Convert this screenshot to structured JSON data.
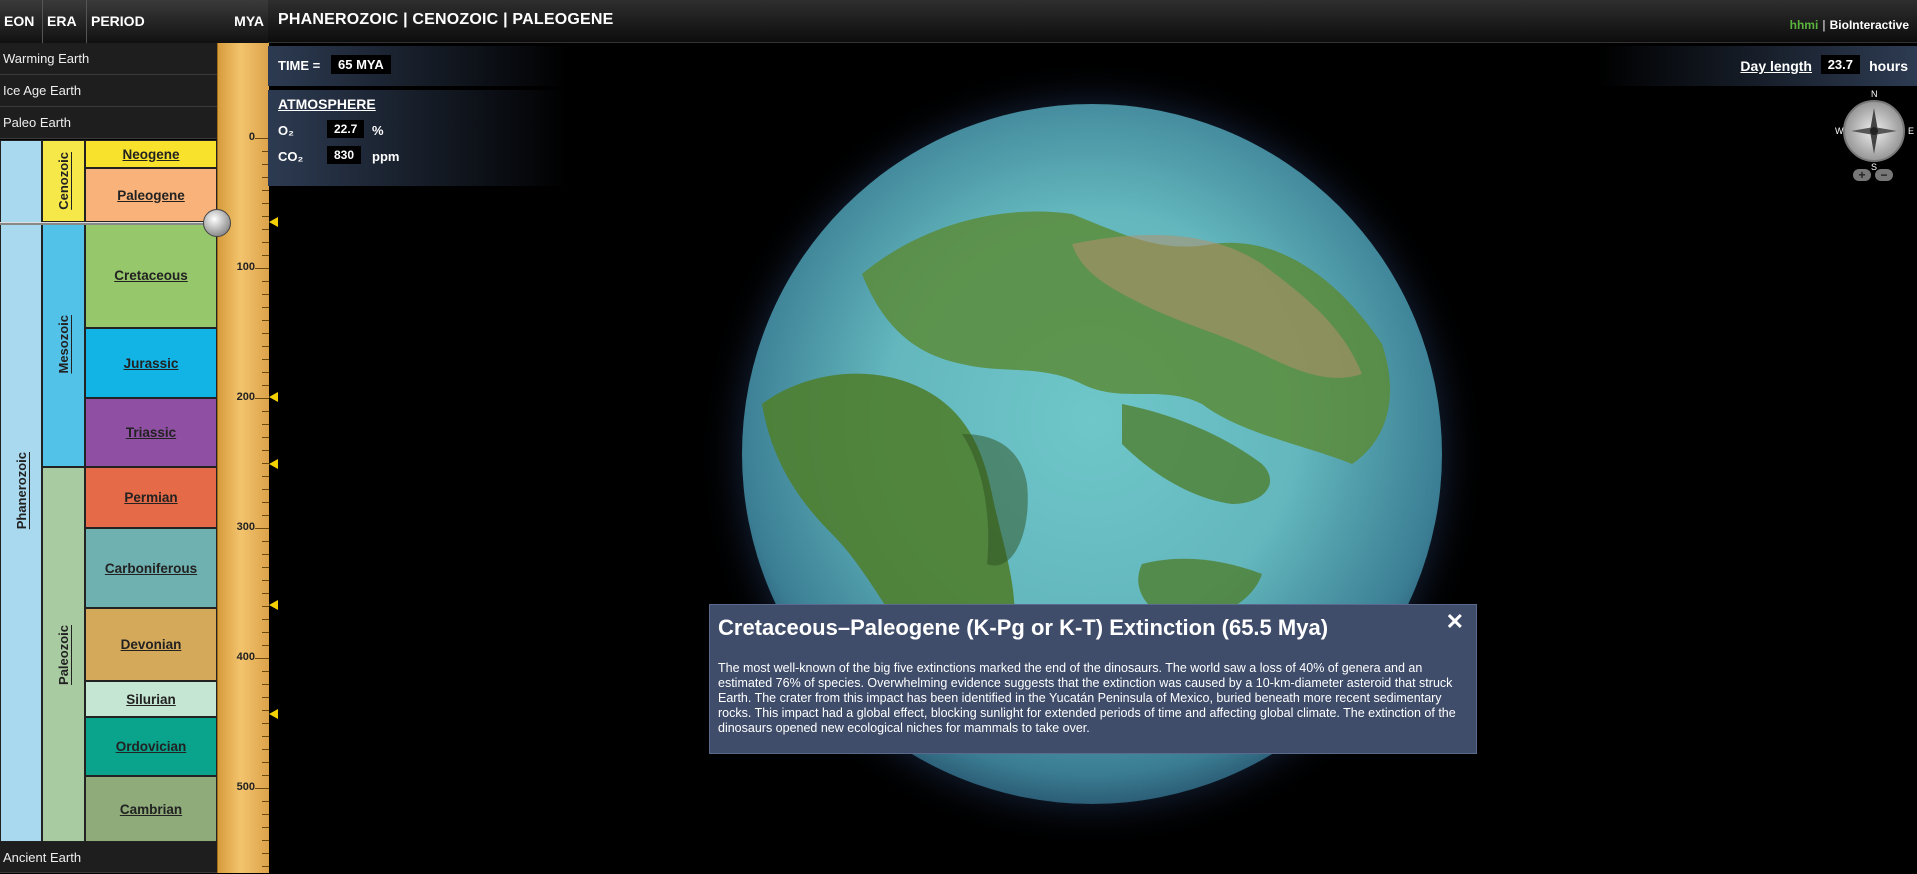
{
  "columns": {
    "eon": "EON",
    "era": "ERA",
    "period": "PERIOD",
    "mya": "MYA"
  },
  "breadcrumb": "PHANEROZOIC | CENOZOIC | PALEOGENE",
  "brand": {
    "hhmi": "hhmi",
    "sep": "|",
    "name": "BioInteractive"
  },
  "menu": {
    "warming": "Warming Earth",
    "ice_age": "Ice Age Earth",
    "paleo": "Paleo Earth",
    "ancient": "Ancient Earth"
  },
  "eon": {
    "label": "Phanerozoic",
    "color": "#a8d9ef"
  },
  "eras": [
    {
      "label": "Cenozoic",
      "color": "#f7e84a"
    },
    {
      "label": "Mesozoic",
      "color": "#52c2e8"
    },
    {
      "label": "Paleozoic",
      "color": "#a9cba1"
    }
  ],
  "periods": [
    {
      "label": "Neogene",
      "color": "#f9e22c"
    },
    {
      "label": "Paleogene",
      "color": "#f9b27a"
    },
    {
      "label": "Cretaceous",
      "color": "#97c76b"
    },
    {
      "label": "Jurassic",
      "color": "#12b4e6"
    },
    {
      "label": "Triassic",
      "color": "#8f4fa2"
    },
    {
      "label": "Permian",
      "color": "#e56b48"
    },
    {
      "label": "Carboniferous",
      "color": "#6fb1b0"
    },
    {
      "label": "Devonian",
      "color": "#d4a95a"
    },
    {
      "label": "Silurian",
      "color": "#c5e6d3"
    },
    {
      "label": "Ordovician",
      "color": "#0aa38c"
    },
    {
      "label": "Cambrian",
      "color": "#8eab79"
    }
  ],
  "ruler": {
    "labels": [
      "0",
      "100",
      "200",
      "300",
      "400",
      "500"
    ]
  },
  "time": {
    "label": "TIME =",
    "value": "65 MYA"
  },
  "atmosphere": {
    "heading": "ATMOSPHERE",
    "o2_label": "O₂",
    "o2_value": "22.7",
    "o2_unit": "%",
    "co2_label": "CO₂",
    "co2_value": "830",
    "co2_unit": "ppm"
  },
  "day_length": {
    "label": "Day length",
    "value": "23.7",
    "unit": "hours"
  },
  "compass": {
    "n": "N",
    "s": "S",
    "e": "E",
    "w": "W"
  },
  "zoom": {
    "in": "+",
    "out": "−"
  },
  "popup": {
    "title": "Cretaceous–Paleogene (K-Pg or K-T) Extinction (65.5 Mya)",
    "close": "✕",
    "body": "The most well-known of the big five extinctions marked the end of the dinosaurs. The world saw a loss of 40% of genera and an estimated 76% of species. Overwhelming evidence suggests that the extinction was caused by a 10-km-diameter asteroid that struck Earth. The crater from this impact has been identified in the Yucatán Peninsula of Mexico, buried beneath more recent sedimentary rocks. This impact had a global effect, blocking sunlight for extended periods of time and affecting global climate. The extinction of the dinosaurs opened new ecological niches for mammals to take over."
  }
}
